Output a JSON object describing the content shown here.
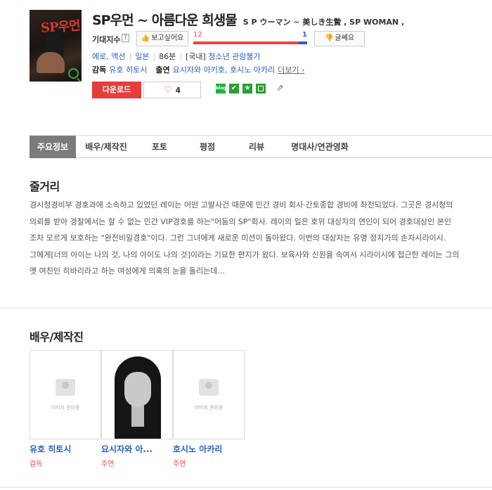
{
  "movie": {
    "title": "SP우먼 ~ 아름다운 희생물",
    "subtitle": "S P ウーマン ~ 美しき生贄 , SP WOMAN ,",
    "poster_title": "SP우먼"
  },
  "expect": {
    "label": "기대지수",
    "help": "?",
    "want_label": "보고싶어요",
    "want_count": "12",
    "nowant_count": "1",
    "want_fraction": 0.923,
    "nowant_label": "글쎄요"
  },
  "meta": {
    "genre": "에로, 액션",
    "country": "일본",
    "runtime": "86분",
    "rating_region": "[국내]",
    "rating": "청소년 관람불가"
  },
  "credits": {
    "director_label": "감독",
    "director": "유호 히토시",
    "cast_label": "출연",
    "cast": "요시자와 아키호, 호시노 아카리",
    "more": "더보기 ›"
  },
  "actions": {
    "download": "다운로드",
    "like_count": "4",
    "blog_text": "blog"
  },
  "tabs": [
    "주요정보",
    "배우/제작진",
    "포토",
    "평점",
    "리뷰",
    "명대사/연관영화"
  ],
  "synopsis": {
    "heading": "줄거리",
    "text": "경시청경비부 경호과에 소속하고 있었던 레이는 어떤 고발사건 때문에 민간 경비 회사·간토종합 경비에 좌천되었다. 그곳은 경시청의 의뢰를 받아 경찰에서는 할 수 없는 민간 VIP경호를 하는\"어둠의 SP\"회사. 레이의 일은 호위 대상자의 연인이 되어 경호대상인 본인 조차 모르게 보호하는 \"완전비밀경호\"이다. 그런 그녀에게 새로운 미션이 돌아왔다. 이번의 대상자는 유명 정치가의 손자시라이시. 그에게[너의 아이는 나의 것, 나의 아이도 나의 것]이라는 기묘한 편지가 왔다. 보육사와 신원을 속여서 시라이시에 접근한 레이는 그의 옛 여친인 히바리라고 하는 여성에게 의혹의 눈을 돌리는데..."
  },
  "people": {
    "heading": "배우/제작진",
    "placeholder": "이미지 준비중",
    "list": [
      {
        "name": "유호 히토시",
        "role": "감독"
      },
      {
        "name": "요시자와 아...",
        "role": "주연"
      },
      {
        "name": "호시노 아카리",
        "role": "주연"
      }
    ]
  }
}
